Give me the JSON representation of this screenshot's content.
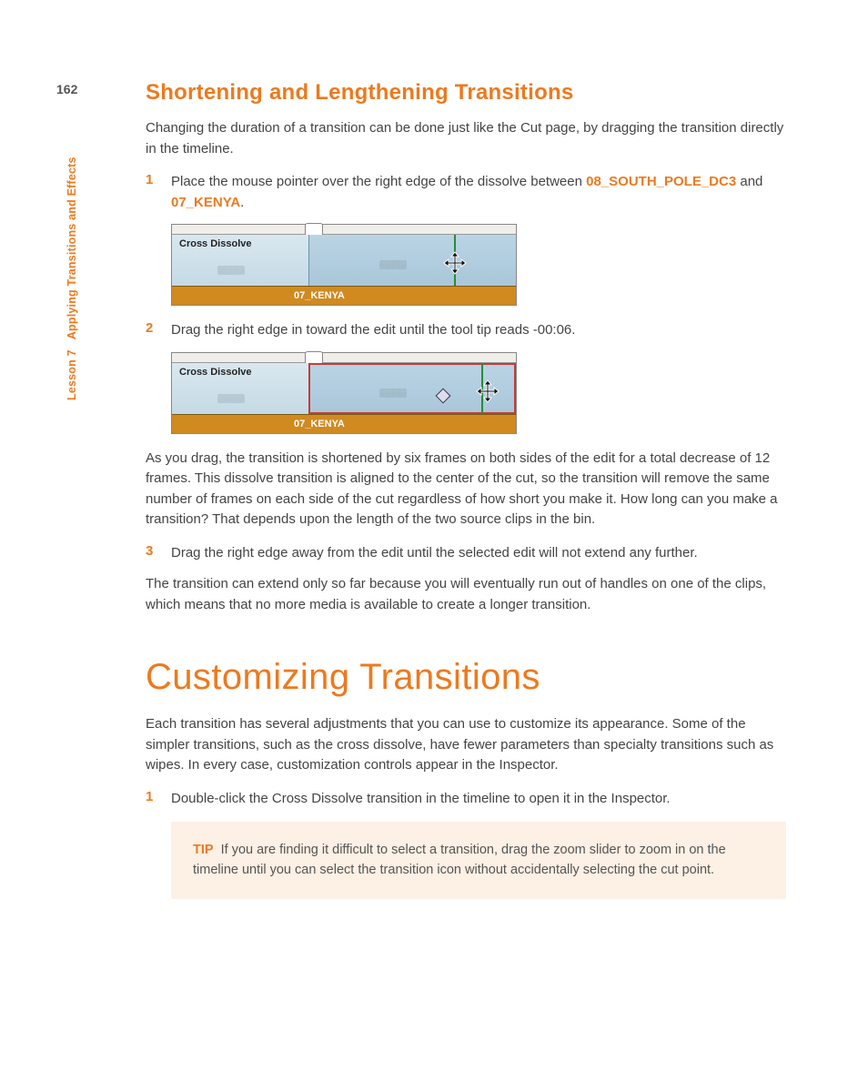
{
  "page_number": "162",
  "side_label": {
    "lesson": "Lesson 7",
    "title": "Applying Transitions and Effects"
  },
  "section1": {
    "title": "Shortening and Lengthening Transitions",
    "intro": "Changing the duration of a transition can be done just like the Cut page, by dragging the transition directly in the timeline.",
    "step1": {
      "num": "1",
      "text_a": "Place the mouse pointer over the right edge of the dissolve between ",
      "clip1": "08_SOUTH_POLE_DC3",
      "text_b": " and ",
      "clip2": "07_KENYA",
      "text_c": "."
    },
    "fig1": {
      "cd_label": "Cross Dissolve",
      "bottom_label": "07_KENYA"
    },
    "step2": {
      "num": "2",
      "text": "Drag the right edge in toward the edit until the tool tip reads -00:06."
    },
    "fig2": {
      "cd_label": "Cross Dissolve",
      "bottom_label": "07_KENYA"
    },
    "para_after_fig2": "As you drag, the transition is shortened by six frames on both sides of the edit for a total decrease of 12 frames. This dissolve transition is aligned to the center of the cut, so the transition will remove the same number of frames on each side of the cut regardless of how short you make it. How long can you make a transition? That depends upon the length of the two source clips in the bin.",
    "step3": {
      "num": "3",
      "text": "Drag the right edge away from the edit until the selected edit will not extend any further."
    },
    "closing": "The transition can extend only so far because you will eventually run out of handles on one of the clips, which means that no more media is available to create a longer transition."
  },
  "section2": {
    "title": "Customizing Transitions",
    "intro": "Each transition has several adjustments that you can use to customize its appearance. Some of the simpler transitions, such as the cross dissolve, have fewer parameters than specialty transitions such as wipes. In every case, customization controls appear in the Inspector.",
    "step1": {
      "num": "1",
      "text": "Double-click the Cross Dissolve transition in the timeline to open it in the Inspector."
    },
    "tip": {
      "label": "TIP",
      "text": "If you are finding it difficult to select a transition, drag the zoom slider to zoom in on the timeline until you can select the transition icon without accidentally selecting the cut point."
    }
  }
}
